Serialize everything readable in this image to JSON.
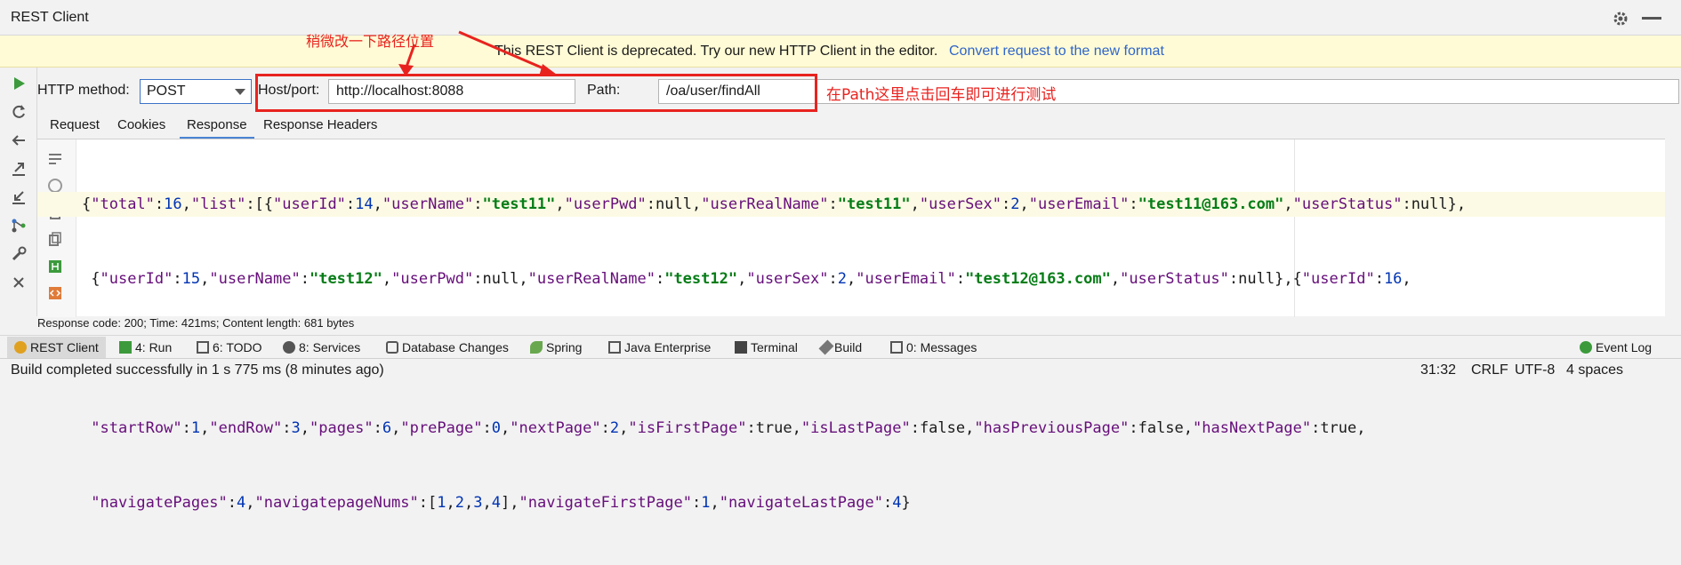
{
  "window": {
    "title": "REST Client"
  },
  "banner": {
    "message": "This REST Client is deprecated. Try our new HTTP Client in the editor.",
    "link": "Convert request to the new format"
  },
  "annotations": {
    "top": "稍微改一下路径位置",
    "right": "在Path这里点击回车即可进行测试"
  },
  "request": {
    "method_label": "HTTP method:",
    "method": "POST",
    "host_label": "Host/port:",
    "host": "http://localhost:8088",
    "path_label": "Path:",
    "path": "/oa/user/findAll"
  },
  "tabs": [
    "Request",
    "Cookies",
    "Response",
    "Response Headers"
  ],
  "active_tab": "Response",
  "response_code": "Response code: 200; Time: 421ms; Content length: 681 bytes",
  "bottom_tabs": [
    {
      "label": "REST Client",
      "icon": "rest-client-icon"
    },
    {
      "label": "4: Run",
      "icon": "run-icon"
    },
    {
      "label": "6: TODO",
      "icon": "todo-icon"
    },
    {
      "label": "8: Services",
      "icon": "services-icon"
    },
    {
      "label": "Database Changes",
      "icon": "database-icon"
    },
    {
      "label": "Spring",
      "icon": "spring-icon"
    },
    {
      "label": "Java Enterprise",
      "icon": "java-enterprise-icon"
    },
    {
      "label": "Terminal",
      "icon": "terminal-icon"
    },
    {
      "label": "Build",
      "icon": "build-icon"
    },
    {
      "label": "0: Messages",
      "icon": "messages-icon"
    },
    {
      "label": "Event Log",
      "icon": "event-log-icon"
    }
  ],
  "status": {
    "message": "Build completed successfully in 1 s 775 ms (8 minutes ago)",
    "position": "31:32",
    "line_sep": "CRLF",
    "encoding": "UTF-8",
    "indent": "4 spaces"
  },
  "colors": {
    "annotation": "#e8231f",
    "link": "#2f65ca",
    "json_key": "#660e7a",
    "json_string": "#067d17",
    "json_number": "#0033b3"
  }
}
